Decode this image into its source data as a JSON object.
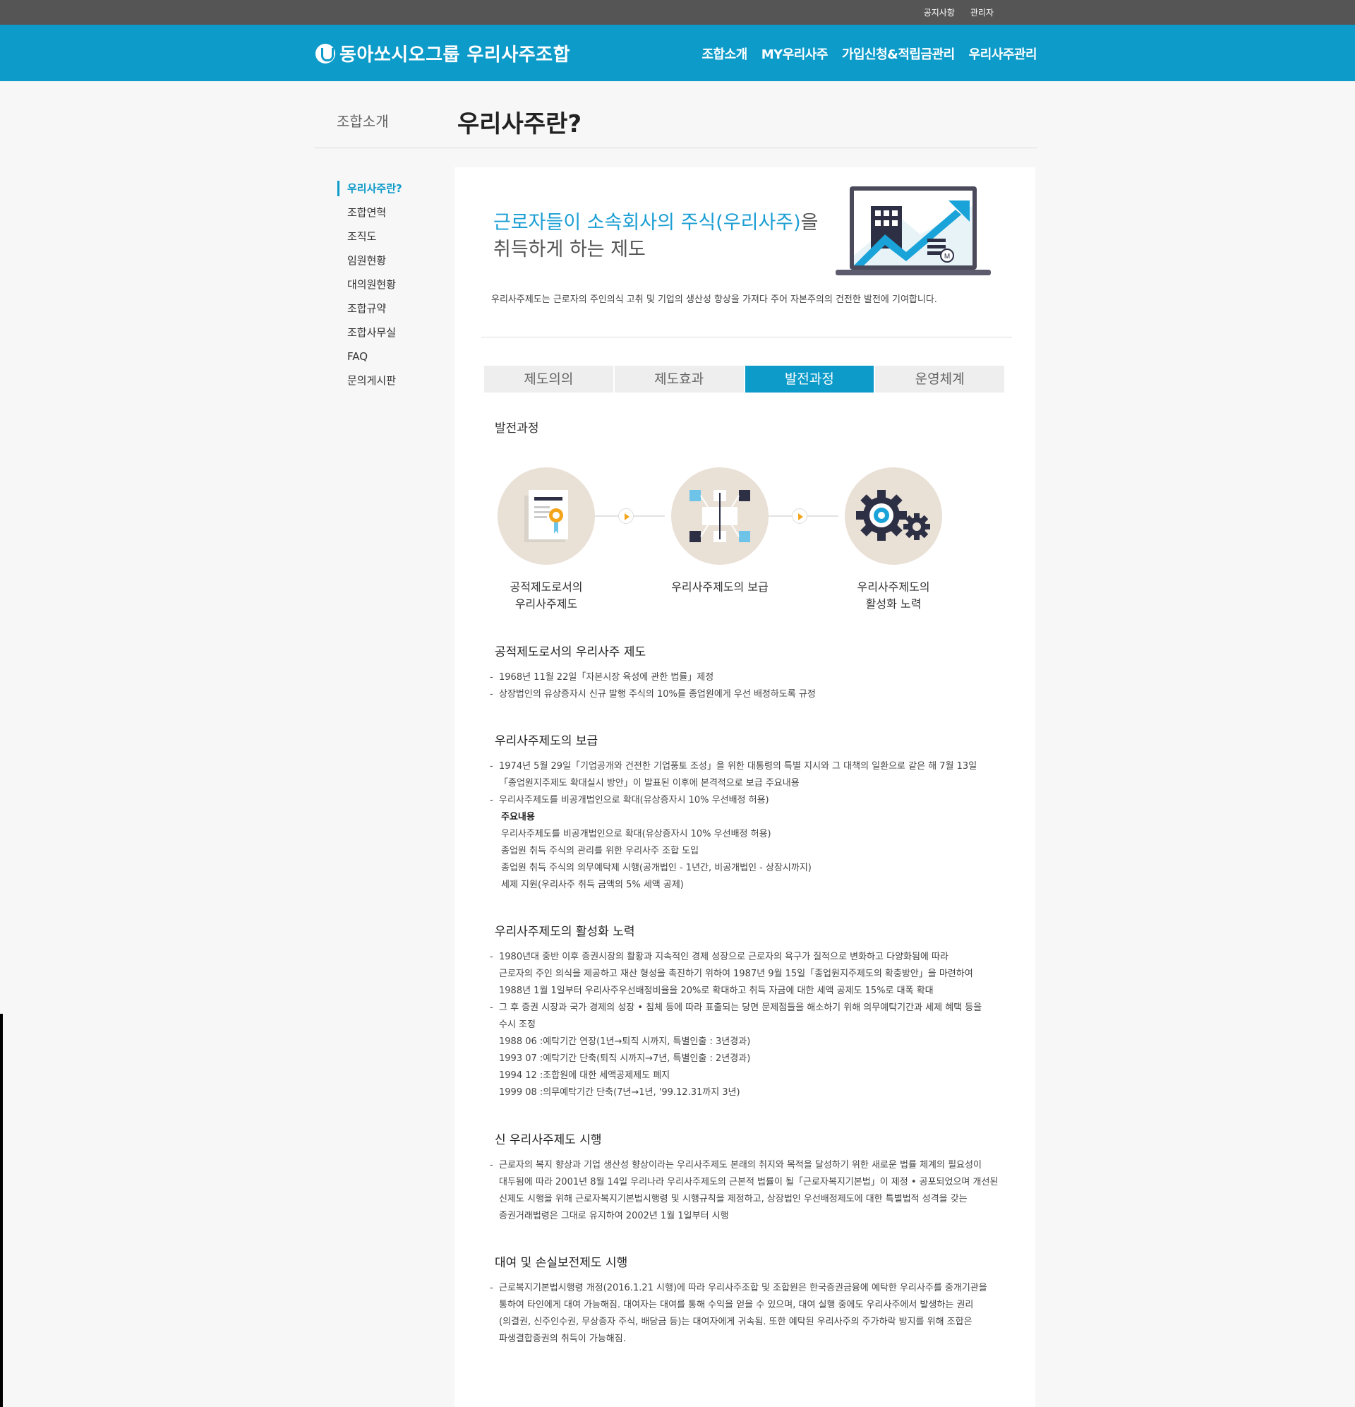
{
  "topbar": {
    "links": [
      "공지사항",
      "관리자"
    ]
  },
  "header": {
    "logo_text": "동아쏘시오그룹 우리사주조합",
    "nav": [
      "조합소개",
      "MY우리사주",
      "가입신청&적립금관리",
      "우리사주관리"
    ]
  },
  "page": {
    "section": "조합소개",
    "title": "우리사주란?"
  },
  "sidebar": {
    "items": [
      {
        "label": "우리사주란?"
      },
      {
        "label": "조합연혁"
      },
      {
        "label": "조직도"
      },
      {
        "label": "임원현황"
      },
      {
        "label": "대의원현황"
      },
      {
        "label": "조합규약"
      },
      {
        "label": "조합사무실"
      },
      {
        "label": "FAQ"
      },
      {
        "label": "문의게시판"
      }
    ],
    "active_index": 0
  },
  "intro": {
    "heading_highlight": "근로자들이 소속회사의 주식(우리사주)",
    "heading_suffix": "을",
    "heading_line2": "취득하게 하는 제도",
    "description": "우리사주제도는 근로자의 주인의식 고취 및 기업의 생산성 향상을 가져다 주어 자본주의의 건전한 발전에 기여합니다."
  },
  "tabs": [
    {
      "label": "제도의의"
    },
    {
      "label": "제도효과"
    },
    {
      "label": "발전과정"
    },
    {
      "label": "운영체계"
    }
  ],
  "active_tab": 2,
  "process": {
    "heading": "발전과정",
    "steps": [
      {
        "label_line1": "공적제도로서의",
        "label_line2": "우리사주제도",
        "icon": "certificate-icon"
      },
      {
        "label_line1": "우리사주제도의 보급",
        "label_line2": "",
        "icon": "network-icon"
      },
      {
        "label_line1": "우리사주제도의",
        "label_line2": "활성화 노력",
        "icon": "gears-icon"
      }
    ]
  },
  "sections": [
    {
      "title": "공적제도로서의 우리사주 제도",
      "lines": [
        {
          "type": "item",
          "text": "1968년 11월 22일「자본시장 육성에 관한 법률」제정"
        },
        {
          "type": "item",
          "text": "상장법인의 유상증자시 신규 발행 주식의 10%를 종업원에게 우선 배정하도록 규정"
        }
      ]
    },
    {
      "title": "우리사주제도의 보급",
      "lines": [
        {
          "type": "item",
          "text": "1974년 5월 29일「기업공개와 건전한 기업풍토 조성」을 위한 대통령의 특별 지시와 그 대책의 일환으로 같은 해 7월 13일"
        },
        {
          "type": "cont",
          "text": "「종업원지주제도 확대실시 방안」이 발표된 이후에 본격적으로 보급 주요내용"
        },
        {
          "type": "item",
          "text": "우리사주제도를 비공개법인으로 확대(유상증자시 10% 우선배정 허용)"
        },
        {
          "type": "sub bold",
          "text": "주요내용"
        },
        {
          "type": "sub",
          "text": "우리사주제도를 비공개법인으로 확대(유상증자시 10% 우선배정 허용)"
        },
        {
          "type": "sub",
          "text": "종업원 취득 주식의 관리를 위한 우리사주 조합 도입"
        },
        {
          "type": "sub",
          "text": "종업원 취득 주식의 의무예탁제 시행(공개법인 - 1년간, 비공개법인 - 상장시까지)"
        },
        {
          "type": "sub",
          "text": "세제 지원(우리사주 취득 금액의 5% 세액 공제)"
        }
      ]
    },
    {
      "title": "우리사주제도의 활성화 노력",
      "lines": [
        {
          "type": "item",
          "text": "1980년대 중반 이후 증권시장의 활황과 지속적인 경제 성장으로 근로자의 욕구가 질적으로 변화하고 다양화됨에 따라"
        },
        {
          "type": "cont",
          "text": "근로자의 주인 의식을 제공하고 재산 형성을 촉진하기 위하여 1987년 9월 15일「종업원지주제도의 확충방안」을 마련하여"
        },
        {
          "type": "cont",
          "text": "1988년 1월 1일부터 우리사주우선배정비율을 20%로 확대하고 취득 자금에 대한 세액 공제도 15%로 대폭 확대"
        },
        {
          "type": "item",
          "text": "그 후 증권 시장과 국가 경제의 성장 • 침체 등에 따라 표출되는 당면 문제점들을 해소하기 위해 의무예탁기간과 세제 혜택 등을"
        },
        {
          "type": "cont",
          "text": "수시 조정"
        },
        {
          "type": "cont",
          "text": "1988 06 :예탁기간 연장(1년→퇴직 시까지, 특별인출 : 3년경과)"
        },
        {
          "type": "cont",
          "text": "1993 07 :예탁기간 단축(퇴직 시까지→7년, 특별인출 : 2년경과)"
        },
        {
          "type": "cont",
          "text": "1994 12 :조합원에 대한 세액공제제도 폐지"
        },
        {
          "type": "cont",
          "text": "1999 08 :의무예탁기간 단축(7년→1년, '99.12.31까지 3년)"
        }
      ]
    },
    {
      "title": "신 우리사주제도 시행",
      "lines": [
        {
          "type": "item",
          "text": "근로자의 복지 향상과 기업 생산성 향상이라는 우리사주제도 본래의 취지와 목적을 달성하기 위한 새로운 법률 체계의 필요성이"
        },
        {
          "type": "cont",
          "text": "대두됨에 따라 2001년 8월 14일 우리나라 우리사주제도의 근본적 법률이 될「근로자복지기본법」이 제정 • 공포되었으며 개선된"
        },
        {
          "type": "cont",
          "text": "신제도 시행을 위해 근로자복지기본법시행령 및 시행규칙을 제정하고, 상장법인 우선배정제도에 대한 특별법적 성격을 갖는"
        },
        {
          "type": "cont",
          "text": "증권거래법령은 그대로 유지하여 2002년 1월 1일부터 시행"
        }
      ]
    },
    {
      "title": "대여 및 손실보전제도 시행",
      "lines": [
        {
          "type": "item",
          "text": "근로복지기본법시행령 개정(2016.1.21 시행)에 따라 우리사주조합 및 조합원은 한국증권금융에 예탁한 우리사주를 중개기관을"
        },
        {
          "type": "cont",
          "text": "통하여 타인에게 대여 가능해짐. 대여자는 대여를 통해 수익을 얻을 수 있으며, 대여 실행 중에도 우리사주에서 발생하는 권리"
        },
        {
          "type": "cont",
          "text": "(의결권, 신주인수권, 무상증자 주식, 배당금 등)는 대여자에게 귀속됨. 또한 예탁된 우리사주의 주가하락 방지를 위해 조합은"
        },
        {
          "type": "cont",
          "text": "파생결합증권의 취득이 가능해짐."
        }
      ]
    }
  ],
  "colors": {
    "brand": "#0d9bc9",
    "topbar": "#555555",
    "accent_arrow": "#f2a41b",
    "icon_circle": "#e9e0d6"
  }
}
